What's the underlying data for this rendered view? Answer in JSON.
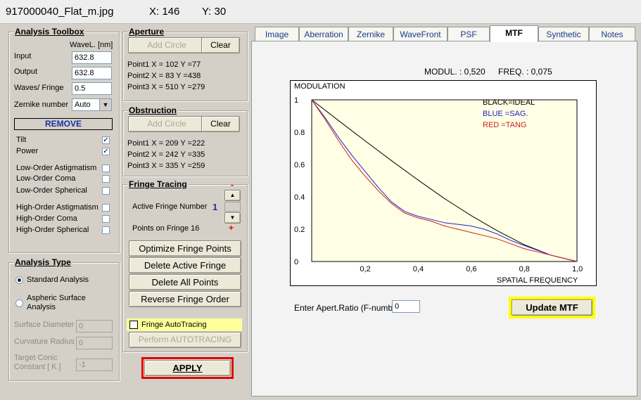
{
  "titlebar": {
    "filename": "917000040_Flat_m.jpg",
    "x_label": "X: 146",
    "y_label": "Y: 30"
  },
  "toolbox": {
    "title": "Analysis Toolbox",
    "wavel_header": "WaveL. [nm]",
    "input_label": "Input",
    "input_value": "632.8",
    "output_label": "Output",
    "output_value": "632.8",
    "waves_label": "Waves/ Fringe",
    "waves_value": "0.5",
    "zernike_label": "Zernike number",
    "zernike_value": "Auto",
    "remove_label": "REMOVE",
    "checks": [
      {
        "label": "Tilt",
        "checked": true
      },
      {
        "label": "Power",
        "checked": true
      },
      {
        "label": "Low-Order Astigmatism",
        "checked": false
      },
      {
        "label": "Low-Order  Coma",
        "checked": false
      },
      {
        "label": "Low-Order Spherical",
        "checked": false
      },
      {
        "label": "High-Order Astigmatism",
        "checked": false
      },
      {
        "label": "High-Order  Coma",
        "checked": false
      },
      {
        "label": "High-Order Spherical",
        "checked": false
      }
    ]
  },
  "analysis_type": {
    "title": "Analysis Type",
    "standard": "Standard Analysis",
    "aspheric_1": "Aspheric  Surface",
    "aspheric_2": "Analysis",
    "surface_diameter_label": "Surface Diameter",
    "surface_diameter_value": "0",
    "curvature_radius_label": "Curvature Radius",
    "curvature_radius_value": "0",
    "target_conic_1": "Target Conic",
    "target_conic_2": "Constant [ K ]",
    "target_conic_value": "-1"
  },
  "aperture": {
    "title": "Aperture",
    "add_label": "Add Circle",
    "clear_label": "Clear",
    "points": [
      "Point1 X =   102   Y =77",
      "Point2 X =   83   Y =438",
      "Point3 X =   510   Y =279"
    ]
  },
  "obstruction": {
    "title": "Obstruction",
    "add_label": "Add Circle",
    "clear_label": "Clear",
    "points": [
      "Point1 X =   209   Y =222",
      "Point2 X =   242   Y =335",
      "Point3 X =   335   Y =259"
    ]
  },
  "fringe": {
    "title": "Fringe Tracing",
    "active_label": "Active Fringe Number",
    "active_value": "1",
    "points_label": "Points on  Fringe 16",
    "minus": "-",
    "plus": "+",
    "optimize": "Optimize Fringe Points",
    "delete_active": "Delete Active Fringe",
    "delete_all": "Delete  All  Points",
    "reverse": "Reverse  Fringe Order",
    "autotracing_label": "Fringe AutoTracing",
    "perform": "Perform  AUTOTRACING"
  },
  "apply_label": "APPLY",
  "tabs": [
    "Image",
    "Aberration",
    "Zernike",
    "WaveFront",
    "PSF",
    "MTF",
    "Synthetic",
    "Notes"
  ],
  "active_tab": "MTF",
  "mtf": {
    "modul": "MODUL. :  0,520",
    "freq": "FREQ. :  0,075",
    "aperture_label": "Enter Apert.Ratio (F-number)",
    "aperture_value": "0",
    "update_label": "Update MTF"
  },
  "chart_data": {
    "type": "line",
    "ylabel": "MODULATION",
    "xlabel": "SPATIAL FREQUENCY",
    "xlim": [
      0,
      1.0
    ],
    "ylim": [
      0,
      1.0
    ],
    "x_ticks": [
      "0,2",
      "0,4",
      "0,6",
      "0,8",
      "1,0"
    ],
    "y_ticks": [
      "0",
      "0.2",
      "0.4",
      "0.6",
      "0.8",
      "1"
    ],
    "legend": [
      "BLACK=IDEAL",
      "BLUE  =SAG.",
      "RED    =TANG"
    ],
    "colors": {
      "ideal": "#000000",
      "sag": "#1f1fcc",
      "tang": "#cc1f1f"
    },
    "series": [
      {
        "name": "BLACK=IDEAL",
        "x": [
          0,
          0.1,
          0.2,
          0.3,
          0.4,
          0.5,
          0.6,
          0.7,
          0.8,
          0.9,
          1.0
        ],
        "y": [
          1.0,
          0.873,
          0.748,
          0.625,
          0.505,
          0.39,
          0.285,
          0.19,
          0.105,
          0.04,
          0.0
        ]
      },
      {
        "name": "BLUE  =SAG.",
        "x": [
          0,
          0.05,
          0.1,
          0.15,
          0.2,
          0.25,
          0.3,
          0.35,
          0.4,
          0.45,
          0.5,
          0.55,
          0.6,
          0.65,
          0.7,
          0.75,
          0.8,
          0.85,
          0.9,
          0.95,
          1.0
        ],
        "y": [
          1.0,
          0.89,
          0.77,
          0.66,
          0.56,
          0.46,
          0.37,
          0.31,
          0.28,
          0.26,
          0.24,
          0.23,
          0.22,
          0.2,
          0.17,
          0.13,
          0.1,
          0.07,
          0.04,
          0.02,
          0.0
        ]
      },
      {
        "name": "RED    =TANG",
        "x": [
          0,
          0.05,
          0.1,
          0.15,
          0.2,
          0.25,
          0.3,
          0.35,
          0.4,
          0.45,
          0.5,
          0.55,
          0.6,
          0.65,
          0.7,
          0.75,
          0.8,
          0.85,
          0.9,
          0.95,
          1.0
        ],
        "y": [
          1.0,
          0.88,
          0.75,
          0.63,
          0.53,
          0.44,
          0.36,
          0.3,
          0.27,
          0.25,
          0.22,
          0.2,
          0.18,
          0.16,
          0.14,
          0.11,
          0.08,
          0.06,
          0.04,
          0.02,
          0.0
        ]
      }
    ]
  }
}
